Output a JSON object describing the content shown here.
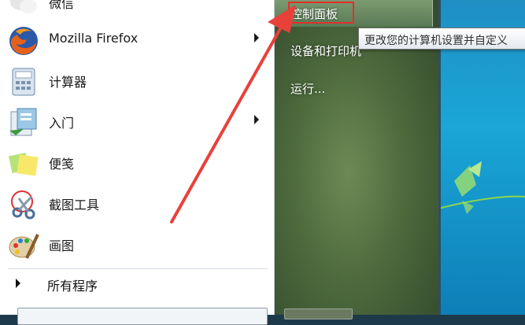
{
  "start_menu": {
    "left_items": [
      {
        "label": "微信",
        "icon": "wechat-icon",
        "has_submenu": false
      },
      {
        "label": "Mozilla Firefox",
        "icon": "firefox-icon",
        "has_submenu": true
      },
      {
        "label": "计算器",
        "icon": "calculator-icon",
        "has_submenu": false
      },
      {
        "label": "入门",
        "icon": "getting-started-icon",
        "has_submenu": true
      },
      {
        "label": "便笺",
        "icon": "sticky-notes-icon",
        "has_submenu": false
      },
      {
        "label": "截图工具",
        "icon": "snipping-tool-icon",
        "has_submenu": false
      },
      {
        "label": "画图",
        "icon": "paint-icon",
        "has_submenu": false
      }
    ],
    "all_programs": "所有程序",
    "right_items": [
      {
        "label": "控制面板"
      },
      {
        "label": "设备和打印机"
      },
      {
        "label": "运行..."
      }
    ]
  },
  "tooltip": {
    "text": "更改您的计算机设置并自定义"
  },
  "annotation": {
    "arrow_color": "#e8413a",
    "highlight_color": "#e0302b"
  }
}
